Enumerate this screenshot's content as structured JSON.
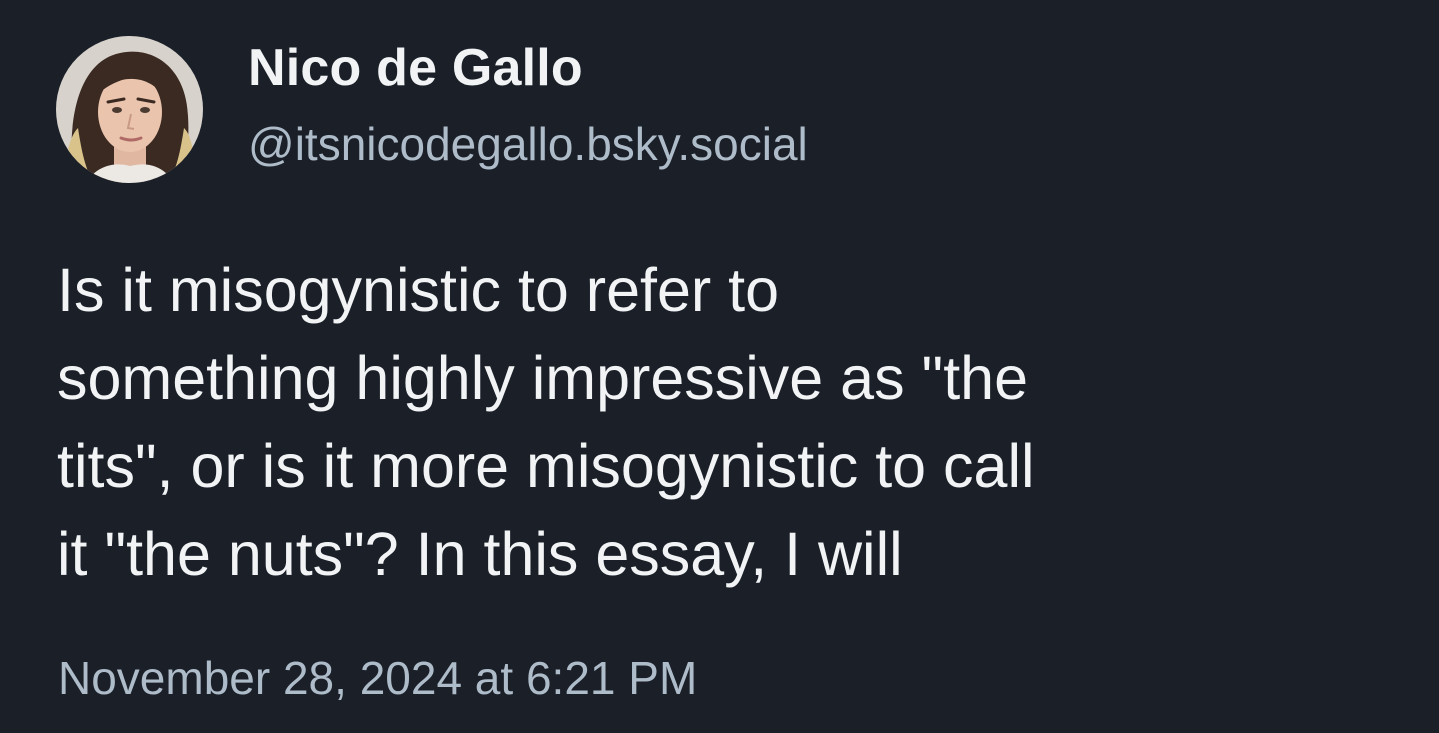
{
  "post": {
    "author": {
      "display_name": "Nico de Gallo",
      "handle": "@itsnicodegallo.bsky.social",
      "avatar_icon": "profile-photo"
    },
    "text": "Is it misogynistic to refer to\nsomething highly impressive as \"the\ntits\", or is it more misogynistic to call\nit \"the nuts\"? In this essay, I will",
    "timestamp": "November 28, 2024 at 6:21 PM"
  },
  "colors": {
    "background": "#1a1f28",
    "primary_text": "#f1f3f5",
    "secondary_text": "#aebbc9"
  }
}
